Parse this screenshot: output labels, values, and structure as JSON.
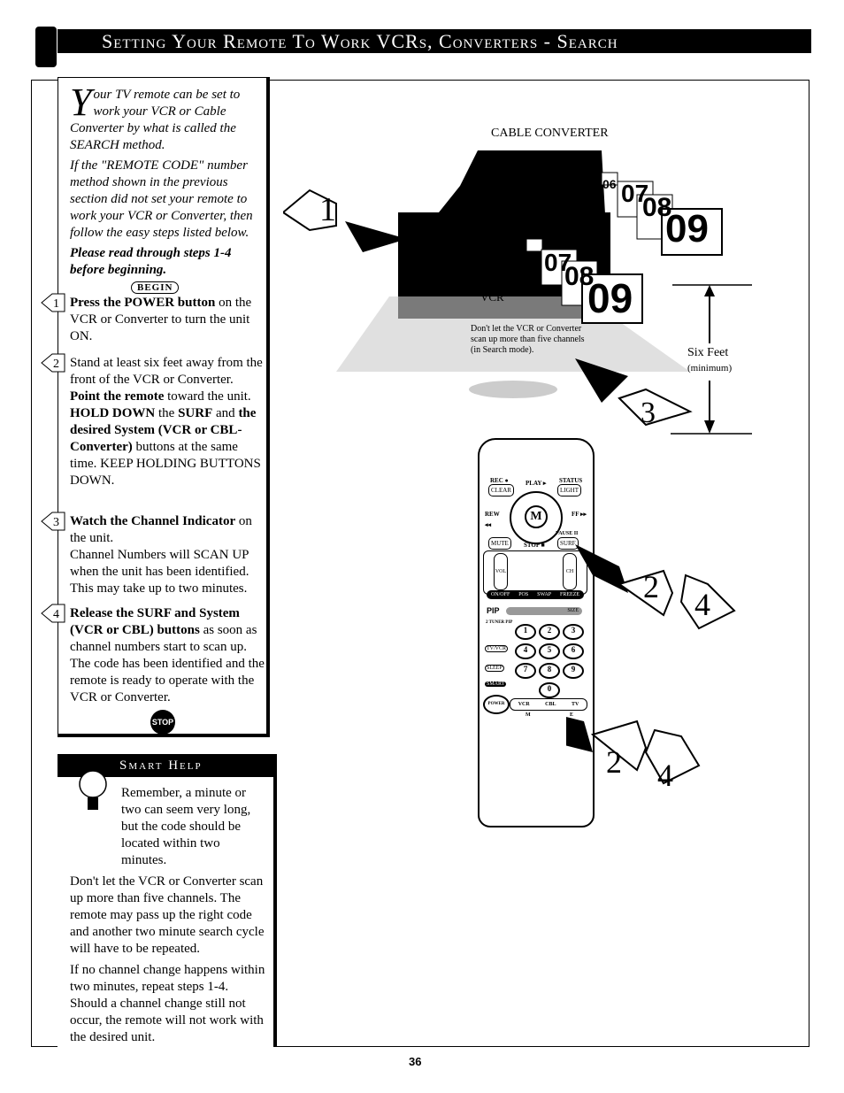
{
  "header": {
    "title": "Setting Your Remote To Work VCRs, Converters - Search",
    "icon": "remote-icon"
  },
  "intro": {
    "drop_cap": "Y",
    "text": "our TV remote can be set to work your VCR or Cable Converter by what is called the SEARCH method.",
    "para2": "If the \"REMOTE CODE\" number method shown in the previous section did not set your remote to work your VCR or Converter, then follow the easy steps listed below.",
    "note": "Please read through steps 1-4 before beginning."
  },
  "begin_label": "BEGIN",
  "steps": [
    {
      "num": "1",
      "bold": "Press the POWER button",
      "text": " on the VCR or Converter to turn the unit ON."
    },
    {
      "num": "2",
      "text": "Stand at least six feet away from the front of the VCR or Converter.",
      "bold2": "Point the remote",
      "text2": " toward the unit. ",
      "bold3": "HOLD DOWN",
      "text3": " the ",
      "bold4": "SURF",
      "text4": " and ",
      "bold5": "the desired System (VCR or CBL-Converter)",
      "text5": " buttons at the same time. KEEP HOLDING BUTTONS DOWN."
    },
    {
      "num": "3",
      "bold": "Watch the Channel Indicator",
      "text": " on the unit.",
      "text2": "Channel Numbers will SCAN UP when the unit has been identified. This may take up to two minutes."
    },
    {
      "num": "4",
      "bold": "Release the SURF and System (VCR or CBL) buttons",
      "text": " as soon as channel numbers start to scan up. The code has been identified and the remote is ready to operate with the VCR or Converter."
    }
  ],
  "stop_label": "STOP",
  "smart_help": {
    "title": "Smart Help",
    "icon": "lightbulb-icon",
    "paras": [
      "Remember, a minute or two can seem very long, but the code should be located within two minutes.",
      "Don't let the VCR or Converter scan up more than five channels. The remote may pass up the right code and another two minute search cycle will have to be repeated.",
      "If no channel change happens within two minutes, repeat steps 1-4. Should a channel change still not occur, the remote will not work with the desired unit."
    ]
  },
  "illustration": {
    "cable_converter_label": "CABLE CONVERTER",
    "vcr_label": "VCR",
    "channels": [
      "06",
      "07",
      "08",
      "09"
    ],
    "caption": [
      "Don't let the VCR or Converter",
      "scan up more than five channels",
      "(in Search mode)."
    ],
    "distance_label": "Six Feet",
    "distance_sub": "(minimum)",
    "step_arrows": [
      "1",
      "3",
      "2",
      "4",
      "2",
      "4"
    ],
    "remote_buttons": {
      "rec": "REC ●",
      "clear": "CLEAR",
      "play": "PLAY ▸",
      "status": "STATUS",
      "light": "LIGHT",
      "rew": "REW ◂◂",
      "ff": "FF ▸▸",
      "menu": "M",
      "mute": "MUTE",
      "stop": "STOP ■",
      "pause": "PAUSE II",
      "surf": "SURF",
      "vol": "VOL",
      "ch": "CH",
      "pip_row": [
        "ON/OFF",
        "POS",
        "SWAP",
        "FREEZE"
      ],
      "pip": "PIP",
      "size": "SIZE",
      "tuner": "2 TUNER PIP",
      "digits": [
        "1",
        "2",
        "3",
        "4",
        "5",
        "6",
        "7",
        "8",
        "9",
        "0"
      ],
      "tvvcr": "TV/VCR",
      "sleep": "SLEEP",
      "smart": "SMART",
      "power": "POWER",
      "vcr": "VCR",
      "cbl": "CBL",
      "tv": "TV",
      "m": "M",
      "e": "E"
    }
  },
  "page_number": "36"
}
